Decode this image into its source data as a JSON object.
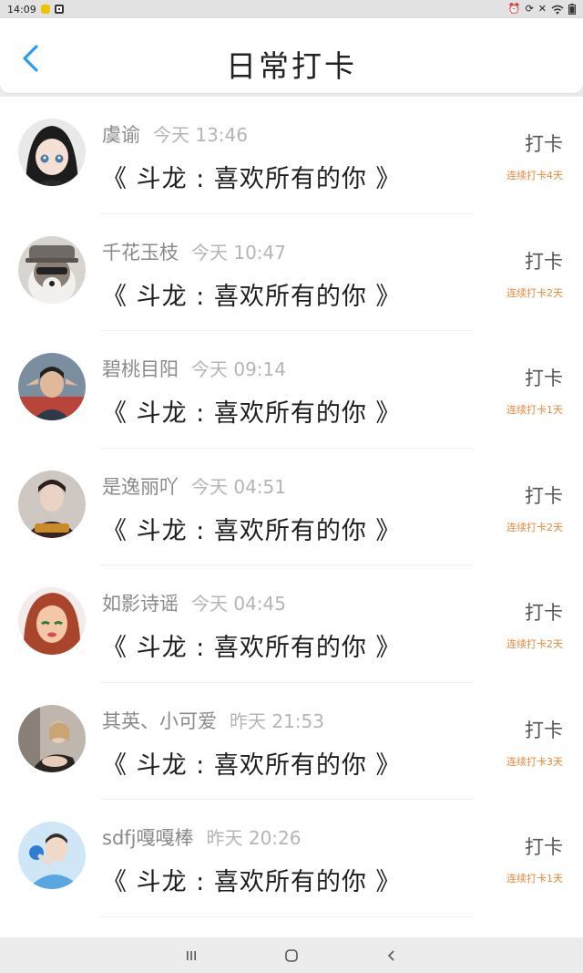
{
  "status_bar": {
    "time": "14:09",
    "icons": [
      "notification-icon",
      "app-icon",
      "alarm-icon",
      "sync-icon",
      "mute-icon",
      "wifi-icon",
      "battery-icon"
    ]
  },
  "header": {
    "title": "日常打卡",
    "back_icon": "chevron-left-icon",
    "accent_color": "#2b9af3"
  },
  "items": [
    {
      "name": "虞谕",
      "time": "今天 13:46",
      "book": "《 斗龙 : 喜欢所有的你 》",
      "action": "打卡",
      "streak": "连续打卡4天"
    },
    {
      "name": "千花玉枝",
      "time": "今天 10:47",
      "book": "《 斗龙 : 喜欢所有的你 》",
      "action": "打卡",
      "streak": "连续打卡2天"
    },
    {
      "name": "碧桃目阳",
      "time": "今天 09:14",
      "book": "《 斗龙 : 喜欢所有的你 》",
      "action": "打卡",
      "streak": "连续打卡1天"
    },
    {
      "name": "是逸丽吖",
      "time": "今天 04:51",
      "book": "《 斗龙 : 喜欢所有的你 》",
      "action": "打卡",
      "streak": "连续打卡2天"
    },
    {
      "name": "如影诗谣",
      "time": "今天 04:45",
      "book": "《 斗龙 : 喜欢所有的你 》",
      "action": "打卡",
      "streak": "连续打卡2天"
    },
    {
      "name": "其英、小可爱",
      "time": "昨天 21:53",
      "book": "《 斗龙 : 喜欢所有的你 》",
      "action": "打卡",
      "streak": "连续打卡3天"
    },
    {
      "name": "sdfj嘎嘎棒",
      "time": "昨天 20:26",
      "book": "《 斗龙 : 喜欢所有的你 》",
      "action": "打卡",
      "streak": "连续打卡1天"
    }
  ],
  "nav": {
    "recents_icon": "recents-icon",
    "home_icon": "home-icon",
    "back_icon": "back-icon"
  }
}
